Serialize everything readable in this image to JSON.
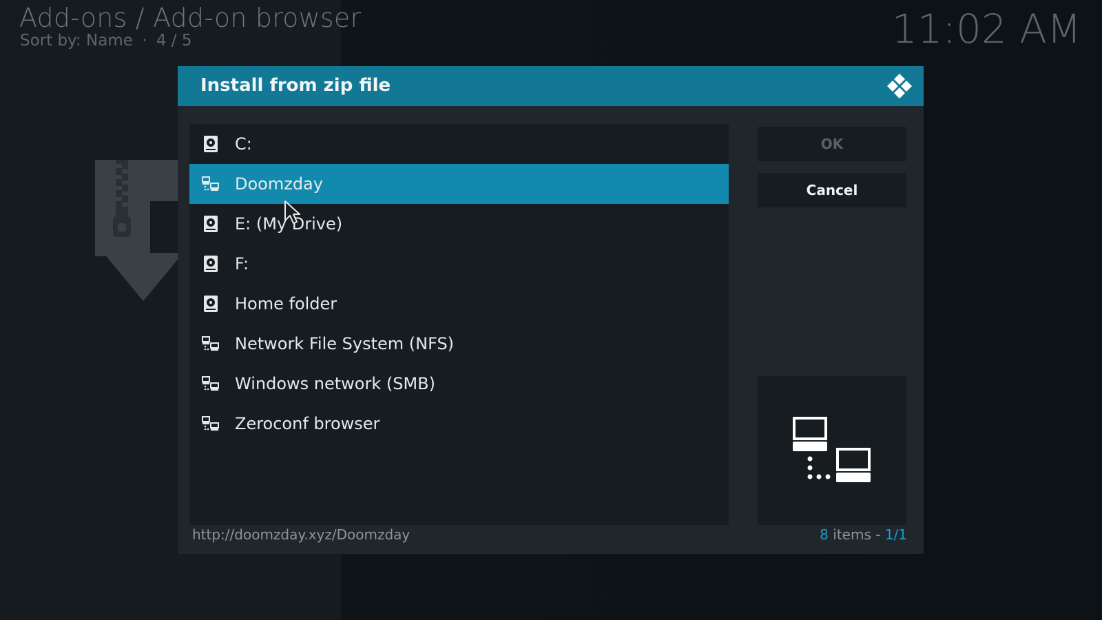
{
  "header": {
    "title": "Add-ons / Add-on browser",
    "subtitle_sort": "Sort by: Name",
    "subtitle_sep": "·",
    "subtitle_pos": "4 / 5"
  },
  "clock": "11:02 AM",
  "background_icon": "zip-install-icon",
  "dialog": {
    "title": "Install from zip file",
    "logo": "kodi-logo-icon",
    "items": [
      {
        "label": "C:",
        "icon": "hard-drive-icon",
        "selected": false
      },
      {
        "label": "Doomzday",
        "icon": "network-source-icon",
        "selected": true
      },
      {
        "label": "E: (My Drive)",
        "icon": "hard-drive-icon",
        "selected": false
      },
      {
        "label": "F:",
        "icon": "hard-drive-icon",
        "selected": false
      },
      {
        "label": "Home folder",
        "icon": "hard-drive-icon",
        "selected": false
      },
      {
        "label": "Network File System (NFS)",
        "icon": "network-source-icon",
        "selected": false
      },
      {
        "label": "Windows network (SMB)",
        "icon": "network-source-icon",
        "selected": false
      },
      {
        "label": "Zeroconf browser",
        "icon": "network-source-icon",
        "selected": false
      }
    ],
    "ok_label": "OK",
    "cancel_label": "Cancel",
    "preview_icon": "network-computers-icon",
    "path": "http://doomzday.xyz/Doomzday",
    "count_number": "8",
    "count_word": " items - ",
    "count_page": "1/1"
  },
  "colors": {
    "accent": "#128aad",
    "header_bar": "#137896",
    "dialog_bg": "#1f272c",
    "panel_bg": "#161c20"
  }
}
